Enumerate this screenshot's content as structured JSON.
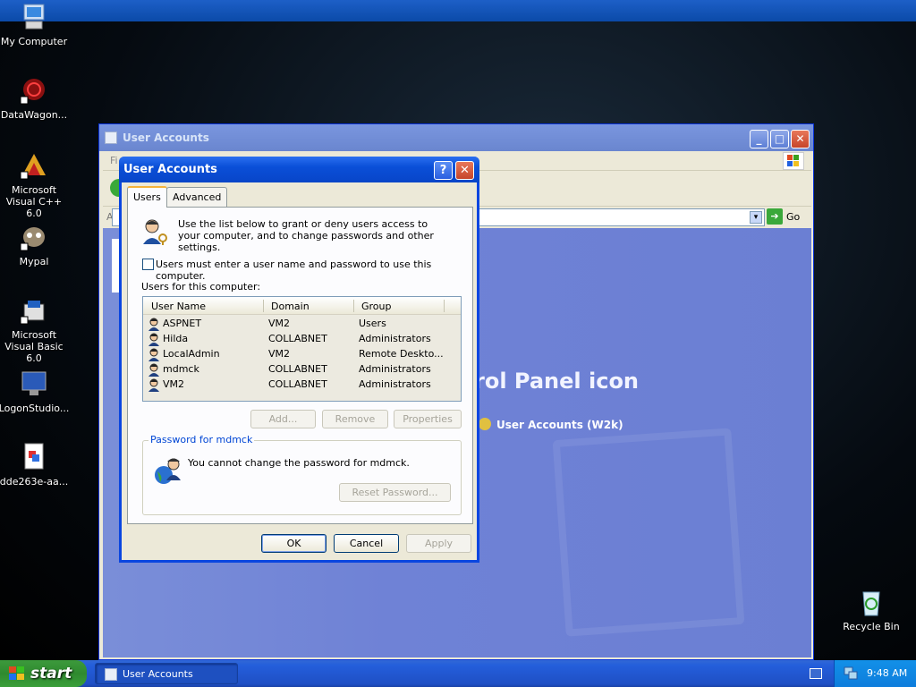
{
  "desktop": {
    "icons": [
      {
        "label": "My Computer"
      },
      {
        "label": "DataWagon..."
      },
      {
        "label": "Microsoft Visual C++ 6.0"
      },
      {
        "label": "Mypal"
      },
      {
        "label": "Microsoft Visual Basic 6.0"
      },
      {
        "label": "LogonStudio..."
      },
      {
        "label": "dde263e-aa..."
      },
      {
        "label": "Recycle Bin"
      }
    ]
  },
  "main_window": {
    "title": "User Accounts",
    "menu_first": "Fi",
    "address_label": "Ad",
    "go_label": "Go",
    "panel_text": "rol Panel icon",
    "panel_link": "User Accounts (W2k)"
  },
  "dialog": {
    "title": "User Accounts",
    "help": "?",
    "close": "✕",
    "tabs": [
      {
        "label": "Users"
      },
      {
        "label": "Advanced"
      }
    ],
    "intro": "Use the list below to grant or deny users access to your computer, and to change passwords and other settings.",
    "require_login_label": "Users must enter a user name and password to use this computer.",
    "require_login_checked": false,
    "users_label": "Users for this computer:",
    "columns": [
      "User Name",
      "Domain",
      "Group"
    ],
    "users": [
      {
        "name": "ASPNET",
        "domain": "VM2",
        "group": "Users"
      },
      {
        "name": "Hilda",
        "domain": "COLLABNET",
        "group": "Administrators"
      },
      {
        "name": "LocalAdmin",
        "domain": "VM2",
        "group": "Remote Deskto..."
      },
      {
        "name": "mdmck",
        "domain": "COLLABNET",
        "group": "Administrators"
      },
      {
        "name": "VM2",
        "domain": "COLLABNET",
        "group": "Administrators"
      }
    ],
    "add_label": "Add...",
    "remove_label": "Remove",
    "properties_label": "Properties",
    "password_group": "Password for mdmck",
    "password_text": "You cannot change the password for mdmck.",
    "reset_label": "Reset Password...",
    "ok_label": "OK",
    "cancel_label": "Cancel",
    "apply_label": "Apply"
  },
  "taskbar": {
    "start_label": "start",
    "task_label": "User Accounts",
    "clock": "9:48 AM"
  }
}
